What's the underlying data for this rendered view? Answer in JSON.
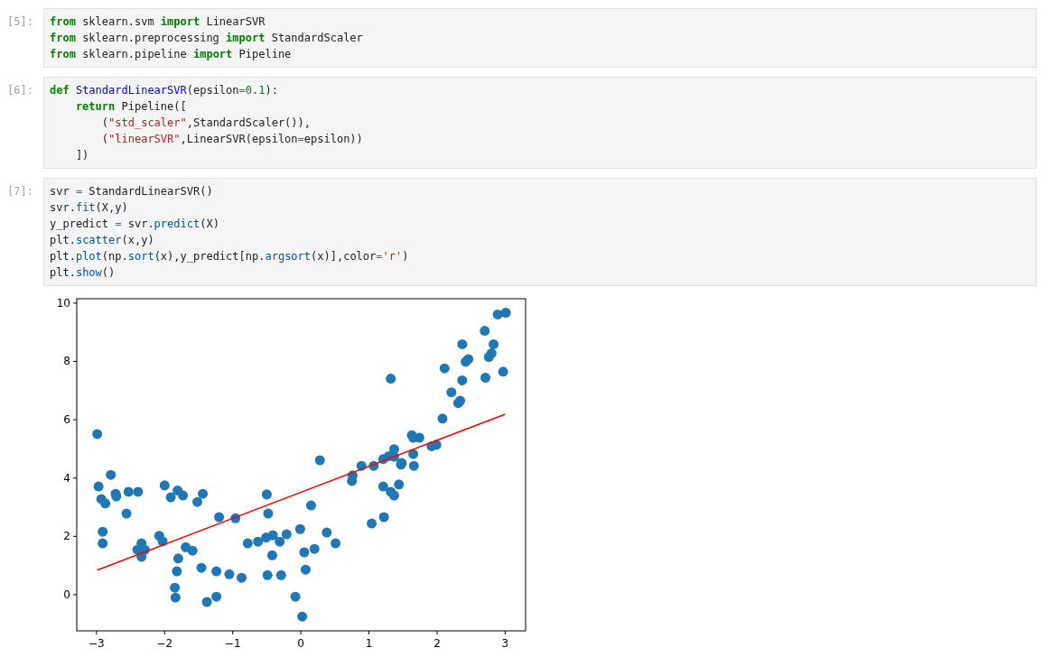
{
  "cells": [
    {
      "prompt": "[5]:",
      "lines": [
        [
          {
            "text": "from",
            "kind": "keyword"
          },
          {
            "text": " sklearn.svm ",
            "kind": "plain"
          },
          {
            "text": "import",
            "kind": "keyword"
          },
          {
            "text": " LinearSVR",
            "kind": "plain"
          }
        ],
        [
          {
            "text": "from",
            "kind": "keyword"
          },
          {
            "text": " sklearn.preprocessing ",
            "kind": "plain"
          },
          {
            "text": "import",
            "kind": "keyword"
          },
          {
            "text": " StandardScaler",
            "kind": "plain"
          }
        ],
        [
          {
            "text": "from",
            "kind": "keyword"
          },
          {
            "text": " sklearn.pipeline ",
            "kind": "plain"
          },
          {
            "text": "import",
            "kind": "keyword"
          },
          {
            "text": " Pipeline",
            "kind": "plain"
          }
        ]
      ]
    },
    {
      "prompt": "[6]:",
      "lines": [
        [
          {
            "text": "def",
            "kind": "keyword"
          },
          {
            "text": " StandardLinearSVR",
            "kind": "function"
          },
          {
            "text": "(epsilon",
            "kind": "plain"
          },
          {
            "text": "=",
            "kind": "operator"
          },
          {
            "text": "0.1",
            "kind": "number"
          },
          {
            "text": "):",
            "kind": "plain"
          }
        ],
        [
          {
            "text": "    return",
            "kind": "keyword"
          },
          {
            "text": " Pipeline([",
            "kind": "plain"
          }
        ],
        [
          {
            "text": "        (",
            "kind": "plain"
          },
          {
            "text": "\"std_scaler\"",
            "kind": "string"
          },
          {
            "text": ",StandardScaler()),",
            "kind": "plain"
          }
        ],
        [
          {
            "text": "        (",
            "kind": "plain"
          },
          {
            "text": "\"linearSVR\"",
            "kind": "string"
          },
          {
            "text": ",LinearSVR(epsilon",
            "kind": "plain"
          },
          {
            "text": "=",
            "kind": "operator"
          },
          {
            "text": "epsilon))",
            "kind": "plain"
          }
        ],
        [
          {
            "text": "    ])",
            "kind": "plain"
          }
        ]
      ]
    },
    {
      "prompt": "[7]:",
      "lines": [
        [
          {
            "text": "svr ",
            "kind": "plain"
          },
          {
            "text": "=",
            "kind": "operator"
          },
          {
            "text": " StandardLinearSVR()",
            "kind": "plain"
          }
        ],
        [
          {
            "text": "svr.",
            "kind": "plain"
          },
          {
            "text": "fit",
            "kind": "method"
          },
          {
            "text": "(X,y)",
            "kind": "plain"
          }
        ],
        [
          {
            "text": "y_predict ",
            "kind": "plain"
          },
          {
            "text": "=",
            "kind": "operator"
          },
          {
            "text": " svr.",
            "kind": "plain"
          },
          {
            "text": "predict",
            "kind": "method"
          },
          {
            "text": "(X)",
            "kind": "plain"
          }
        ],
        [
          {
            "text": "plt.",
            "kind": "plain"
          },
          {
            "text": "scatter",
            "kind": "method"
          },
          {
            "text": "(x,y)",
            "kind": "plain"
          }
        ],
        [
          {
            "text": "plt.",
            "kind": "plain"
          },
          {
            "text": "plot",
            "kind": "method"
          },
          {
            "text": "(np.",
            "kind": "plain"
          },
          {
            "text": "sort",
            "kind": "method"
          },
          {
            "text": "(x),y_predict[np.",
            "kind": "plain"
          },
          {
            "text": "argsort",
            "kind": "method"
          },
          {
            "text": "(x)],color",
            "kind": "plain"
          },
          {
            "text": "=",
            "kind": "operator"
          },
          {
            "text": "'r'",
            "kind": "string"
          },
          {
            "text": ")",
            "kind": "plain"
          }
        ],
        [
          {
            "text": "plt.",
            "kind": "plain"
          },
          {
            "text": "show",
            "kind": "method"
          },
          {
            "text": "()",
            "kind": "plain"
          }
        ]
      ],
      "output": {
        "chart_data": {
          "type": "scatter",
          "xlim": [
            -3.29,
            3.3
          ],
          "ylim": [
            -1.24,
            10.15
          ],
          "xticks": [
            {
              "value": -3,
              "label": "−3"
            },
            {
              "value": -2,
              "label": "−2"
            },
            {
              "value": -1,
              "label": "−1"
            },
            0,
            1,
            2,
            3
          ],
          "yticks": [
            0,
            2,
            4,
            6,
            8,
            10
          ],
          "series": [
            {
              "type": "scatter",
              "color": "#1f77b4",
              "x": [
                -2.99,
                -2.97,
                -2.93,
                -2.87,
                -2.79,
                -2.72,
                -2.71,
                -2.91,
                -2.91,
                -2.56,
                -2.53,
                -2.39,
                -2.4,
                -2.34,
                -2.34,
                -2.29,
                -2.08,
                -2.03,
                -2.0,
                -1.91,
                -1.81,
                -1.73,
                -1.8,
                -1.82,
                -1.85,
                -1.84,
                -1.69,
                -1.59,
                -1.52,
                -1.44,
                -1.46,
                -1.38,
                -1.24,
                -1.24,
                -1.2,
                -1.05,
                -0.96,
                -0.87,
                -0.78,
                -0.63,
                -0.51,
                -0.5,
                -0.48,
                -0.49,
                -0.41,
                -0.42,
                -0.31,
                -0.29,
                -0.21,
                -0.08,
                -0.01,
                0.02,
                0.05,
                0.07,
                0.15,
                0.2,
                0.28,
                0.38,
                0.51,
                0.75,
                0.76,
                0.89,
                1.04,
                1.07,
                1.21,
                1.21,
                1.22,
                1.29,
                1.32,
                1.32,
                1.37,
                1.37,
                1.37,
                1.44,
                1.47,
                1.48,
                1.63,
                1.65,
                1.74,
                1.65,
                1.66,
                1.92,
                1.99,
                2.08,
                2.11,
                2.21,
                2.31,
                2.34,
                2.37,
                2.37,
                2.42,
                2.46,
                2.7,
                2.71,
                2.76,
                2.8,
                2.83,
                2.89,
                2.97,
                3.01
              ],
              "values": [
                5.51,
                3.71,
                3.28,
                3.13,
                4.11,
                3.46,
                3.37,
                2.16,
                1.76,
                2.78,
                3.53,
                3.53,
                1.54,
                1.76,
                1.3,
                1.54,
                2.02,
                1.83,
                3.75,
                3.34,
                3.57,
                3.4,
                1.24,
                0.8,
                0.24,
                -0.1,
                1.63,
                1.51,
                3.18,
                3.46,
                0.92,
                -0.25,
                -0.07,
                0.8,
                2.66,
                0.7,
                2.62,
                0.58,
                1.76,
                1.82,
                1.96,
                3.44,
                2.78,
                0.67,
                2.04,
                1.35,
                1.82,
                0.67,
                2.07,
                -0.07,
                2.25,
                -0.75,
                1.45,
                0.86,
                3.06,
                1.57,
                4.61,
                2.13,
                1.76,
                3.9,
                4.09,
                4.42,
                2.44,
                4.42,
                4.65,
                3.71,
                2.66,
                4.75,
                7.41,
                3.53,
                3.4,
                4.99,
                4.73,
                3.78,
                4.46,
                4.52,
                5.47,
                5.38,
                5.38,
                4.82,
                4.42,
                5.09,
                5.14,
                6.04,
                7.76,
                6.94,
                6.57,
                6.65,
                7.35,
                8.59,
                7.99,
                8.08,
                9.05,
                7.44,
                8.15,
                8.28,
                8.59,
                9.61,
                7.65,
                9.67
              ]
            },
            {
              "type": "line",
              "color": "#ff0000",
              "x": [
                -2.99,
                3.0
              ],
              "values": [
                0.84,
                6.19
              ]
            }
          ]
        }
      }
    }
  ]
}
